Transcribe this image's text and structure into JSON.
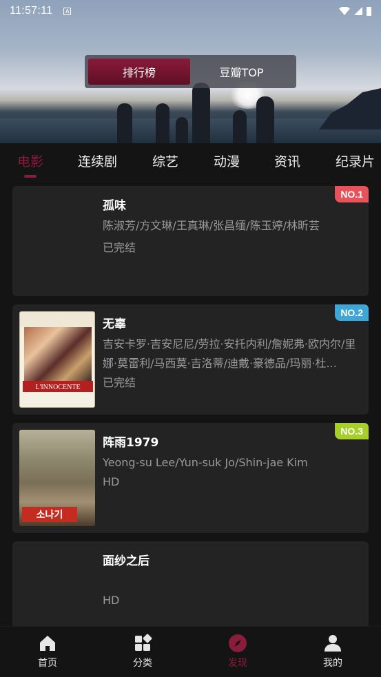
{
  "status_bar": {
    "time": "11:57:11",
    "notification": "A"
  },
  "segment": {
    "active": "排行榜",
    "inactive": "豆瓣TOP"
  },
  "tabs": [
    "电影",
    "连续剧",
    "综艺",
    "动漫",
    "资讯",
    "纪录片"
  ],
  "items": [
    {
      "title": "孤味",
      "cast": "陈淑芳/方文琳/王真琳/张昌缅/陈玉婷/林昕芸",
      "status": "已完结",
      "rank": "NO.1",
      "rank_color": "#e8535b"
    },
    {
      "title": "无辜",
      "cast": "吉安卡罗·吉安尼尼/劳拉·安托内利/詹妮弗·欧内尔/里娜·莫雷利/马西莫·吉洛蒂/迪戴·豪德品/玛丽·杜...",
      "status": "已完结",
      "rank": "NO.2",
      "rank_color": "#3fa7d6",
      "poster_text": "L'INNOCENTE"
    },
    {
      "title": "阵雨1979",
      "cast": "Yeong-su Lee/Yun-suk Jo/Shin-jae Kim",
      "status": "HD",
      "rank": "NO.3",
      "rank_color": "#a6cf2a",
      "poster_text": "소나기"
    },
    {
      "title": "面纱之后",
      "cast": "",
      "status": "HD",
      "rank": ""
    }
  ],
  "bottom_nav": [
    {
      "label": "首页",
      "icon": "home-icon"
    },
    {
      "label": "分类",
      "icon": "category-icon"
    },
    {
      "label": "发现",
      "icon": "compass-icon"
    },
    {
      "label": "我的",
      "icon": "user-icon"
    }
  ],
  "colors": {
    "accent": "#8b1c3a",
    "card_bg": "#232323",
    "page_bg": "#141414"
  }
}
